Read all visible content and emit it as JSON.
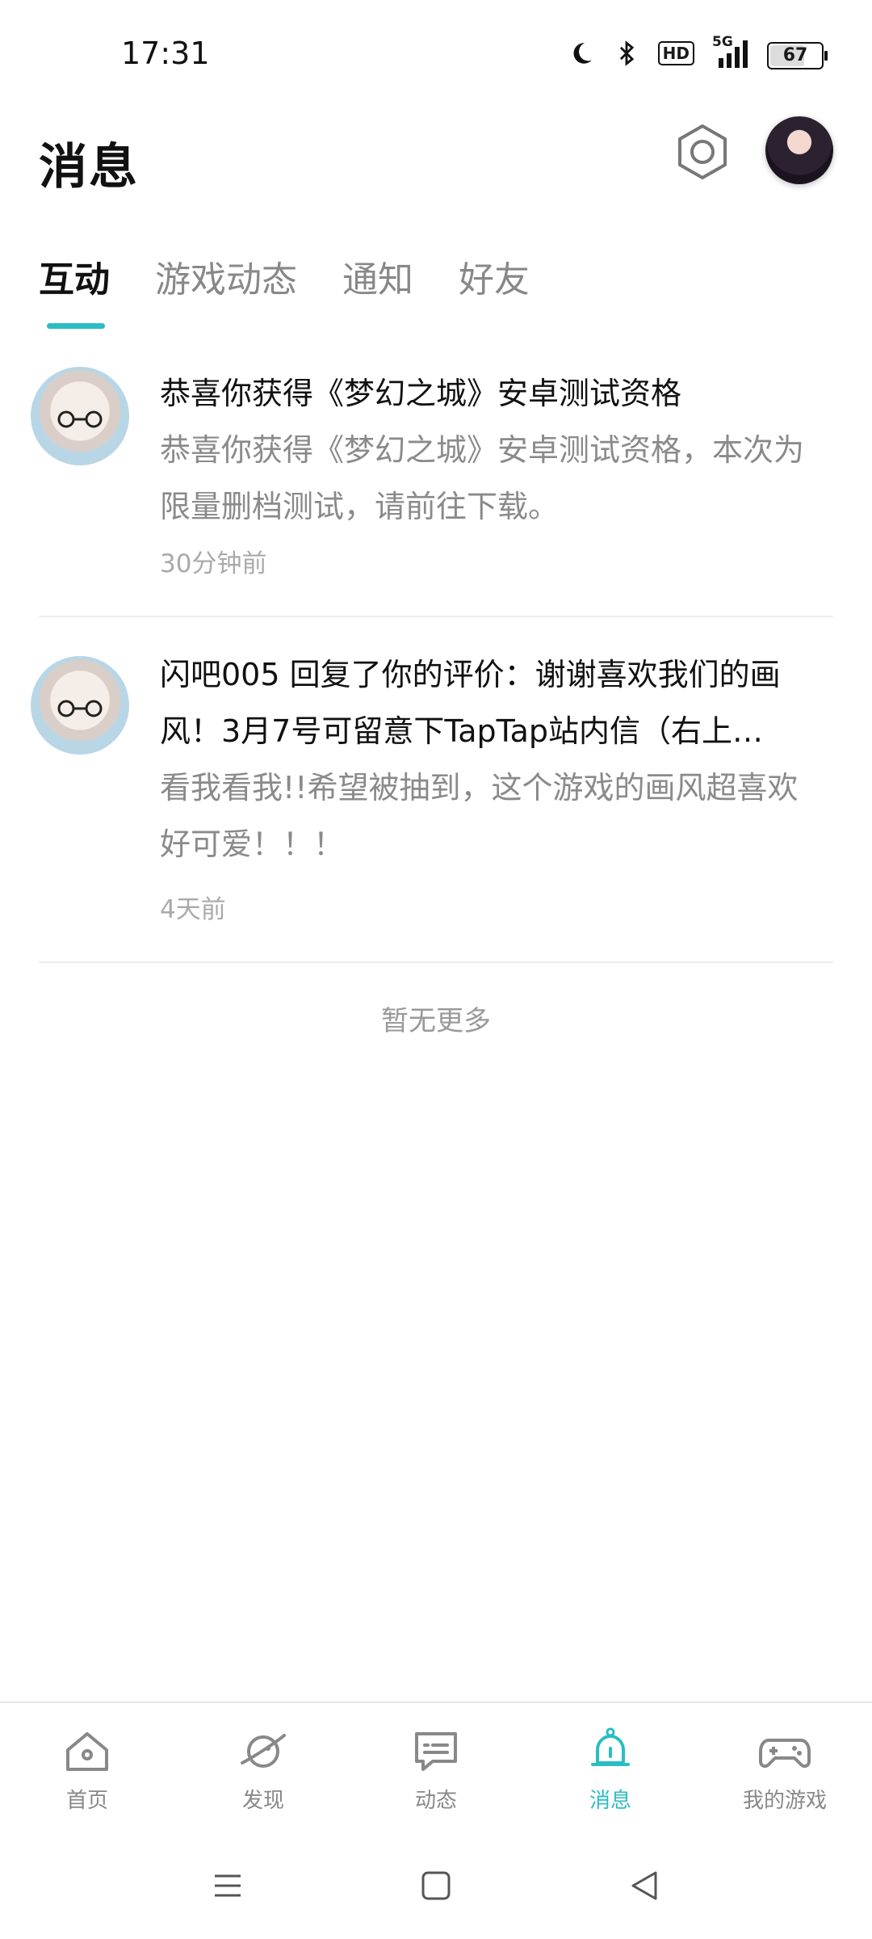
{
  "status_bar": {
    "time": "17:31",
    "network": "5G",
    "hd_badge": "HD",
    "battery": "67"
  },
  "header": {
    "title": "消息",
    "settings_icon": "gear-icon",
    "avatar": "avatar"
  },
  "tabs": [
    {
      "label": "互动",
      "active": true
    },
    {
      "label": "游戏动态",
      "active": false
    },
    {
      "label": "通知",
      "active": false
    },
    {
      "label": "好友",
      "active": false
    }
  ],
  "messages": [
    {
      "title": "恭喜你获得《梦幻之城》安卓测试资格",
      "body": "恭喜你获得《梦幻之城》安卓测试资格，本次为限量删档测试，请前往下载。",
      "time": "30分钟前"
    },
    {
      "title": "闪吧005 回复了你的评价：谢谢喜欢我们的画风！3月7号可留意下TapTap站内信（右上…",
      "body": "看我看我!!希望被抽到，这个游戏的画风超喜欢好可爱！！！",
      "time": "4天前"
    }
  ],
  "list_footer": "暂无更多",
  "bottom_nav": [
    {
      "label": "首页",
      "icon": "home-icon",
      "active": false
    },
    {
      "label": "发现",
      "icon": "planet-icon",
      "active": false
    },
    {
      "label": "动态",
      "icon": "chat-icon",
      "active": false
    },
    {
      "label": "消息",
      "icon": "bell-icon",
      "active": true
    },
    {
      "label": "我的游戏",
      "icon": "gamepad-icon",
      "active": false
    }
  ],
  "colors": {
    "accent": "#2bbdc4",
    "text_primary": "#111111",
    "text_secondary": "#8a8a8a"
  }
}
